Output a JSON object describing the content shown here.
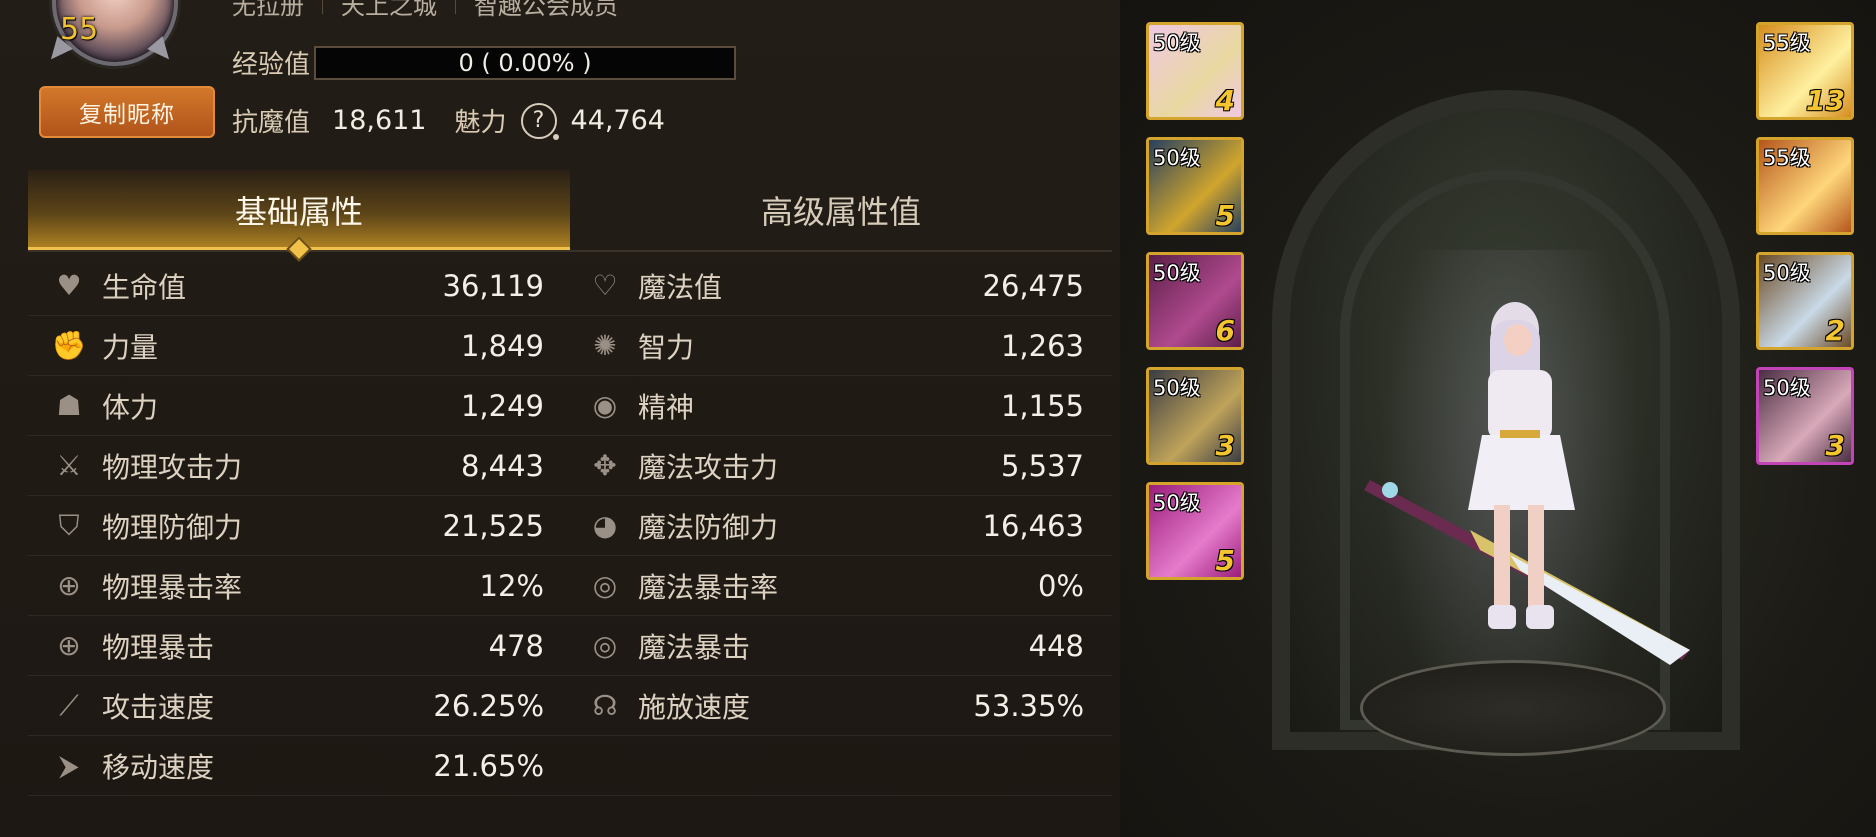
{
  "header": {
    "level": "55",
    "top_texts": [
      "无拉册",
      "天上之城",
      "智趣公会成员"
    ],
    "copy_button_label": "复制昵称",
    "exp_label": "经验值",
    "exp_text": "0 ( 0.00% )",
    "exp_fraction": 0.0,
    "resist_label": "抗魔值",
    "resist_value": "18,611",
    "charm_label": "魅力",
    "help_glyph": "?",
    "charm_value": "44,764"
  },
  "tabs": [
    {
      "label": "基础属性",
      "active": true
    },
    {
      "label": "高级属性值",
      "active": false
    }
  ],
  "stats_left": [
    {
      "icon": "heart-icon",
      "label": "生命值",
      "value": "36,119"
    },
    {
      "icon": "strength-icon",
      "label": "力量",
      "value": "1,849"
    },
    {
      "icon": "body-icon",
      "label": "体力",
      "value": "1,249"
    },
    {
      "icon": "sword-icon",
      "label": "物理攻击力",
      "value": "8,443"
    },
    {
      "icon": "shield-icon",
      "label": "物理防御力",
      "value": "21,525"
    },
    {
      "icon": "crosshair-icon",
      "label": "物理暴击率",
      "value": "12%"
    },
    {
      "icon": "crosshair-icon",
      "label": "物理暴击",
      "value": "478"
    },
    {
      "icon": "attack-speed-icon",
      "label": "攻击速度",
      "value": "26.25%"
    },
    {
      "icon": "boot-icon",
      "label": "移动速度",
      "value": "21.65%"
    }
  ],
  "stats_right": [
    {
      "icon": "heart-outline-icon",
      "label": "魔法值",
      "value": "26,475"
    },
    {
      "icon": "burst-icon",
      "label": "智力",
      "value": "1,263"
    },
    {
      "icon": "spirit-icon",
      "label": "精神",
      "value": "1,155"
    },
    {
      "icon": "magic-attack-icon",
      "label": "魔法攻击力",
      "value": "5,537"
    },
    {
      "icon": "magic-defense-icon",
      "label": "魔法防御力",
      "value": "16,463"
    },
    {
      "icon": "target-icon",
      "label": "魔法暴击率",
      "value": "0%"
    },
    {
      "icon": "target-icon",
      "label": "魔法暴击",
      "value": "448"
    },
    {
      "icon": "cast-speed-icon",
      "label": "施放速度",
      "value": "53.35%"
    }
  ],
  "equipment_left": [
    {
      "name": "top-slot",
      "level": "50级",
      "count": "4",
      "colors": [
        "#f0c8e2",
        "#e8d8a0"
      ]
    },
    {
      "name": "armor-slot",
      "level": "50级",
      "count": "5",
      "colors": [
        "#27405e",
        "#d0a52d"
      ]
    },
    {
      "name": "pants-slot",
      "level": "50级",
      "count": "6",
      "colors": [
        "#5c1f48",
        "#b04a8f"
      ]
    },
    {
      "name": "belt-slot",
      "level": "50级",
      "count": "3",
      "colors": [
        "#3a3c44",
        "#bfa35a"
      ]
    },
    {
      "name": "shoes-slot",
      "level": "50级",
      "count": "5",
      "colors": [
        "#9a1d7a",
        "#e57bcb"
      ]
    }
  ],
  "equipment_right": [
    {
      "name": "weapon-slot",
      "level": "55级",
      "count": "13",
      "colors": [
        "#d68d1f",
        "#fff0a0"
      ],
      "purple": false
    },
    {
      "name": "title-slot",
      "level": "55级",
      "count": "",
      "colors": [
        "#b4561c",
        "#ffd67a"
      ],
      "purple": false
    },
    {
      "name": "necklace-slot",
      "level": "50级",
      "count": "2",
      "colors": [
        "#6b4a25",
        "#c9d9e6"
      ],
      "purple": false
    },
    {
      "name": "ring-slot",
      "level": "50级",
      "count": "3",
      "colors": [
        "#4a2d42",
        "#d8a9b9"
      ],
      "purple": true
    }
  ]
}
